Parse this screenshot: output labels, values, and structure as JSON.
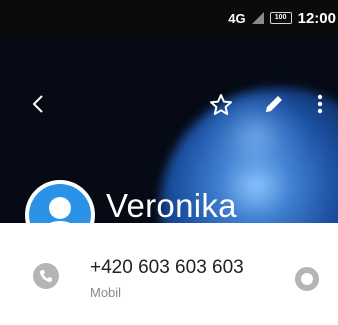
{
  "status_bar": {
    "network": "4G",
    "network_prefix": "⁴⁶",
    "battery": "100",
    "time": "12:00"
  },
  "header": {
    "contact_name": "Veronika"
  },
  "contact": {
    "phone_number": "+420 603 603 603",
    "phone_type": "Mobil"
  },
  "icons": {
    "back": "back-arrow-icon",
    "favorite": "star-icon",
    "edit": "pencil-icon",
    "more": "more-vert-icon",
    "avatar": "person-icon",
    "call": "phone-icon",
    "message": "message-icon"
  }
}
